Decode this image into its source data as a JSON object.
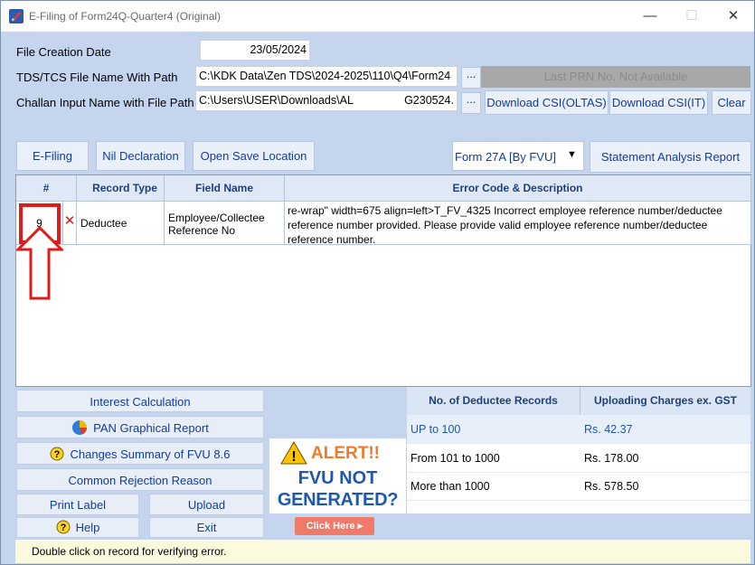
{
  "window": {
    "title": "E-Filing of Form24Q-Quarter4 (Original)",
    "minimize": "—",
    "maximize": "☐",
    "close": "✕"
  },
  "form": {
    "file_creation_date_label": "File Creation Date",
    "file_creation_date": "23/05/2024",
    "tds_file_label": "TDS/TCS File Name With Path",
    "tds_file_path": "C:\\KDK Data\\Zen TDS\\2024-2025\\110\\Q4\\Form24",
    "challan_label": "Challan Input Name with File Path",
    "challan_file_path": "C:\\Users\\USER\\Downloads\\AL",
    "challan_file_path_end": "G230524.",
    "browse": "...",
    "last_prn": "Last PRN No. Not Available",
    "download_oltas": "Download CSI(OLTAS)",
    "download_it": "Download CSI(IT)",
    "clear": "Clear"
  },
  "toolbar": {
    "efiling": "E-Filing",
    "nil_declaration": "Nil Declaration",
    "open_save_location": "Open Save Location",
    "form_select": "Form 27A [By FVU]",
    "statement_analysis": "Statement Analysis Report"
  },
  "grid": {
    "headers": [
      "#",
      "Record Type",
      "Field Name",
      "Error Code & Description"
    ],
    "rows": [
      {
        "num": "9",
        "record_type": "Deductee",
        "field_name": "Employee/Collectee Reference No",
        "description": "re-wrap\" width=675 align=left>T_FV_4325 Incorrect employee reference number/deductee reference number provided. Please provide valid employee reference number/deductee reference number."
      }
    ]
  },
  "left_buttons": {
    "interest_calculation": "Interest Calculation",
    "pan_graphical_report": "PAN Graphical Report",
    "changes_summary": "Changes Summary of FVU 8.6",
    "common_rejection": "Common Rejection Reason",
    "print_label": "Print Label",
    "upload": "Upload",
    "help": "Help",
    "exit": "Exit"
  },
  "alert": {
    "title": "ALERT!!",
    "line1": "FVU NOT",
    "line2": "GENERATED?",
    "button": "Click Here ▸"
  },
  "charges": {
    "headers": [
      "No. of Deductee Records",
      "Uploading Charges ex. GST"
    ],
    "rows": [
      {
        "range": "UP to 100",
        "charge": "Rs. 42.37"
      },
      {
        "range": "From 101 to 1000",
        "charge": "Rs. 178.00"
      },
      {
        "range": "More than 1000",
        "charge": "Rs. 578.50"
      }
    ]
  },
  "status": {
    "message": "Double click on record for verifying error."
  },
  "colors": {
    "window_bg": "#c5d5ee",
    "link_blue": "#123c9a",
    "highlight_red": "#e01b1b",
    "alert_orange": "#f07a2a",
    "alert_blue": "#1f57b0",
    "status_bg": "#fbfadf"
  }
}
